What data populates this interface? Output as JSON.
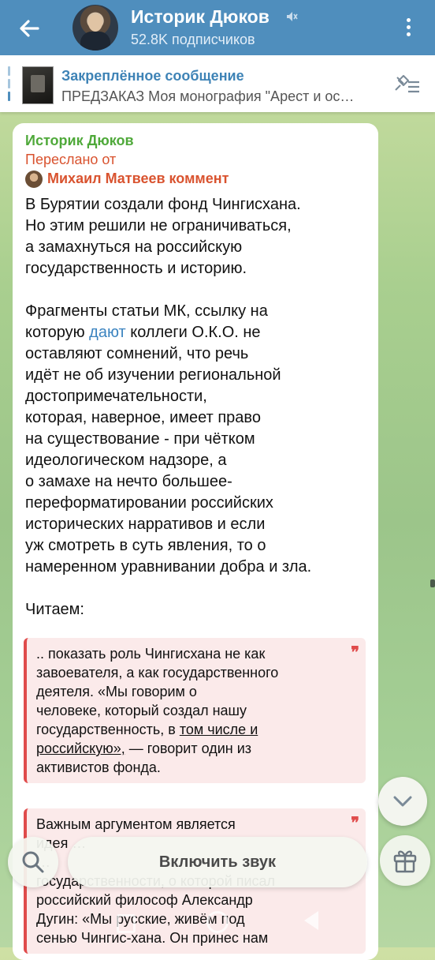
{
  "header": {
    "title": "Историк Дюков",
    "subscribers": "52.8K подписчиков"
  },
  "pinned": {
    "label": "Закреплённое сообщение",
    "text": "ПРЕДЗАКАЗ  Моя монография \"Арест и ос…"
  },
  "message": {
    "author": "Историк Дюков",
    "forwarded_label": "Переслано от",
    "forwarded_from": "Михаил Матвеев коммент",
    "para1": [
      "В Бурятии создали фонд Чингисхана.",
      "Но этим решили не ограничиваться,",
      "а замахнуться на российскую",
      "государственность и историю."
    ],
    "para2_line1": "Фрагменты статьи МК, ссылку на",
    "para2_line2_before": "которую ",
    "para2_link": "дают",
    "para2_line2_after": " коллеги О.К.О. не",
    "para2_rest": [
      "оставляют сомнений, что речь",
      "идёт не об изучении  региональной",
      "достопримечательности,",
      "которая, наверное, имеет право",
      "на существование - при чётком",
      "идеологическом надзоре, а",
      "о замахе на нечто большее-",
      "переформатировании российских",
      "исторических нарративов и если",
      "уж смотреть в суть явления, то о",
      "намеренном уравнивании добра и зла."
    ],
    "reading_label": "Читаем:",
    "quote1_lines": [
      ".. показать роль Чингисхана не как",
      "завоевателя, а как государственного",
      "деятеля. «Мы говорим о",
      "человеке, который создал нашу"
    ],
    "quote1_line5_before": "государственность, в ",
    "quote1_line5_link": "том числе и",
    "quote1_line6_link": "российскую»,",
    "quote1_line6_after": " — говорит один из",
    "quote1_line7": "активистов фонда.",
    "quote_mark": "❞",
    "quote2_lines": [
      "Важным аргументом является",
      "идея …",
      "…",
      "государственности, о которой писал",
      "российский философ Александр",
      "Дугин: «Мы русские, живём под",
      "сенью Чингис-хана. Он принес нам"
    ]
  },
  "controls": {
    "sound_button": "Включить звук"
  },
  "colors": {
    "header_bg": "#4f8ebd",
    "author_green": "#4fa93a",
    "forward_red": "#d9532f",
    "link_blue": "#3c84c0",
    "quote_border": "#e04b4b"
  }
}
